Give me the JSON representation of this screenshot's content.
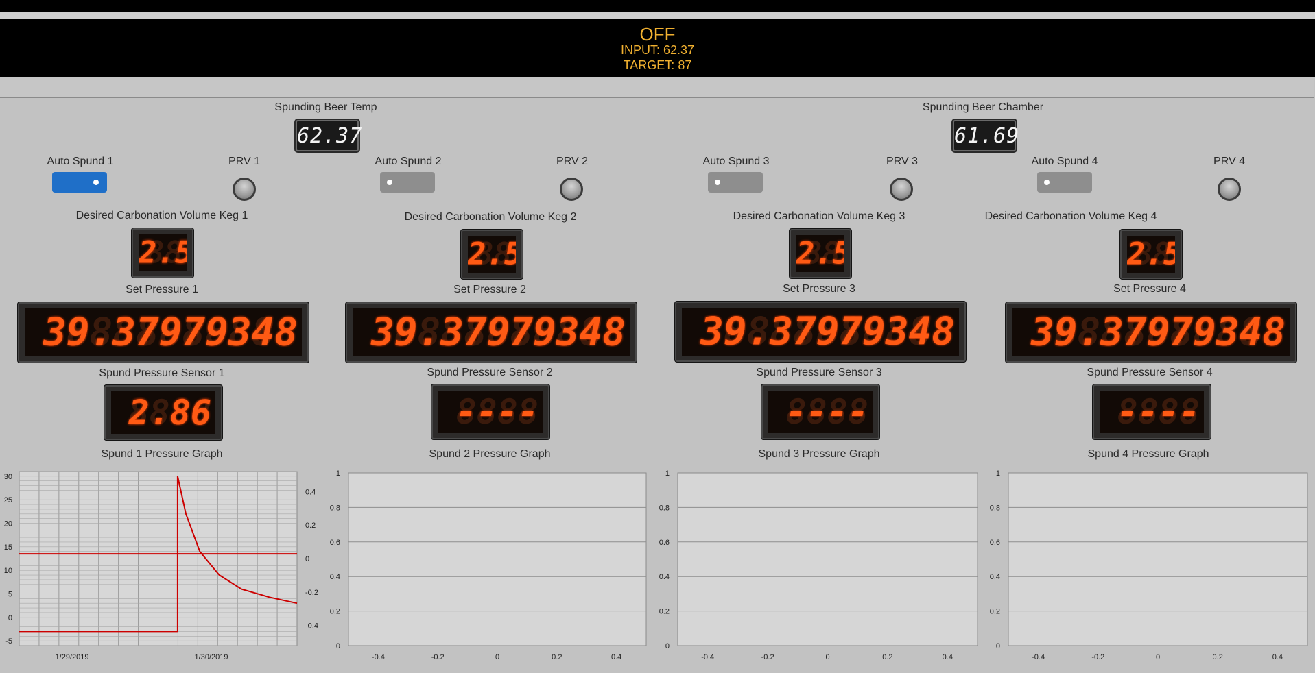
{
  "banner": {
    "status": "OFF",
    "input": "INPUT: 62.37",
    "target": "TARGET: 87"
  },
  "temps": {
    "beer_temp_label": "Spunding Beer Temp",
    "beer_temp_value": "62.37",
    "chamber_label": "Spunding Beer Chamber",
    "chamber_value": "61.69"
  },
  "kegs": [
    {
      "auto_label": "Auto Spund 1",
      "auto_on": true,
      "prv_label": "PRV 1",
      "carb_label": "Desired Carbonation Volume Keg 1",
      "carb_value": "2.5",
      "set_label": "Set Pressure 1",
      "set_value": "39.37979348",
      "sensor_label": "Spund Pressure Sensor 1",
      "sensor_value": "2.86",
      "graph_label": "Spund 1 Pressure Graph"
    },
    {
      "auto_label": "Auto Spund 2",
      "auto_on": false,
      "prv_label": "PRV 2",
      "carb_label": "Desired Carbonation Volume Keg 2",
      "carb_value": "2.5",
      "set_label": "Set Pressure 2",
      "set_value": "39.37979348",
      "sensor_label": "Spund Pressure Sensor 2",
      "sensor_value": "----",
      "graph_label": "Spund 2 Pressure Graph"
    },
    {
      "auto_label": "Auto Spund 3",
      "auto_on": false,
      "prv_label": "PRV 3",
      "carb_label": "Desired Carbonation Volume Keg 3",
      "carb_value": "2.5",
      "set_label": "Set Pressure 3",
      "set_value": "39.37979348",
      "sensor_label": "Spund Pressure Sensor 3",
      "sensor_value": "----",
      "graph_label": "Spund 3 Pressure Graph"
    },
    {
      "auto_label": "Auto Spund 4",
      "auto_on": false,
      "prv_label": "PRV 4",
      "carb_label": "Desired Carbonation Volume Keg 4",
      "carb_value": "2.5",
      "set_label": "Set Pressure 4",
      "set_value": "39.37979348",
      "sensor_label": "Spund Pressure Sensor 4",
      "sensor_value": "----",
      "graph_label": "Spund 4 Pressure Graph"
    }
  ],
  "colors": {
    "led_on": "#ff5a14",
    "toggle_on": "#1f6fc8",
    "toggle_off": "#8e8e8e",
    "banner_text": "#f0b030",
    "trace": "#cc0000"
  },
  "chart_data": [
    {
      "type": "line",
      "title": "Spund 1 Pressure Graph",
      "x": [
        "1/29/2019",
        "",
        "",
        "",
        "",
        "1/30/2019",
        "",
        "",
        "",
        "",
        "",
        "",
        "",
        ""
      ],
      "x_tick_labels": [
        "1/29/2019",
        "1/30/2019"
      ],
      "y_left_ticks": [
        -5,
        0,
        5,
        10,
        15,
        20,
        25,
        30
      ],
      "y_right_ticks": [
        -0.4,
        -0.2,
        0,
        0.2,
        0.4
      ],
      "series": [
        {
          "axis": "left",
          "values": [
            [
              0,
              -3
            ],
            [
              0.57,
              -3
            ],
            [
              0.57,
              30
            ],
            [
              0.6,
              22
            ],
            [
              0.65,
              14
            ],
            [
              0.72,
              9
            ],
            [
              0.8,
              6
            ],
            [
              0.9,
              4.3
            ],
            [
              1.0,
              3
            ]
          ]
        },
        {
          "axis": "left",
          "values": [
            [
              0,
              13.5
            ],
            [
              1.0,
              13.5
            ]
          ]
        }
      ],
      "ylim": [
        -6,
        31
      ],
      "grid": true
    },
    {
      "type": "line",
      "title": "Spund 2 Pressure Graph",
      "x_ticks": [
        -0.4,
        -0.2,
        0,
        0.2,
        0.4
      ],
      "y_ticks": [
        0,
        0.2,
        0.4,
        0.6,
        0.8,
        1
      ],
      "series": [],
      "xlim": [
        -0.5,
        0.5
      ],
      "ylim": [
        0,
        1
      ]
    },
    {
      "type": "line",
      "title": "Spund 3 Pressure Graph",
      "x_ticks": [
        -0.4,
        -0.2,
        0,
        0.2,
        0.4
      ],
      "y_ticks": [
        0,
        0.2,
        0.4,
        0.6,
        0.8,
        1
      ],
      "series": [],
      "xlim": [
        -0.5,
        0.5
      ],
      "ylim": [
        0,
        1
      ]
    },
    {
      "type": "line",
      "title": "Spund 4 Pressure Graph",
      "x_ticks": [
        -0.4,
        -0.2,
        0,
        0.2,
        0.4
      ],
      "y_ticks": [
        0,
        0.2,
        0.4,
        0.6,
        0.8,
        1
      ],
      "series": [],
      "xlim": [
        -0.5,
        0.5
      ],
      "ylim": [
        0,
        1
      ]
    }
  ]
}
